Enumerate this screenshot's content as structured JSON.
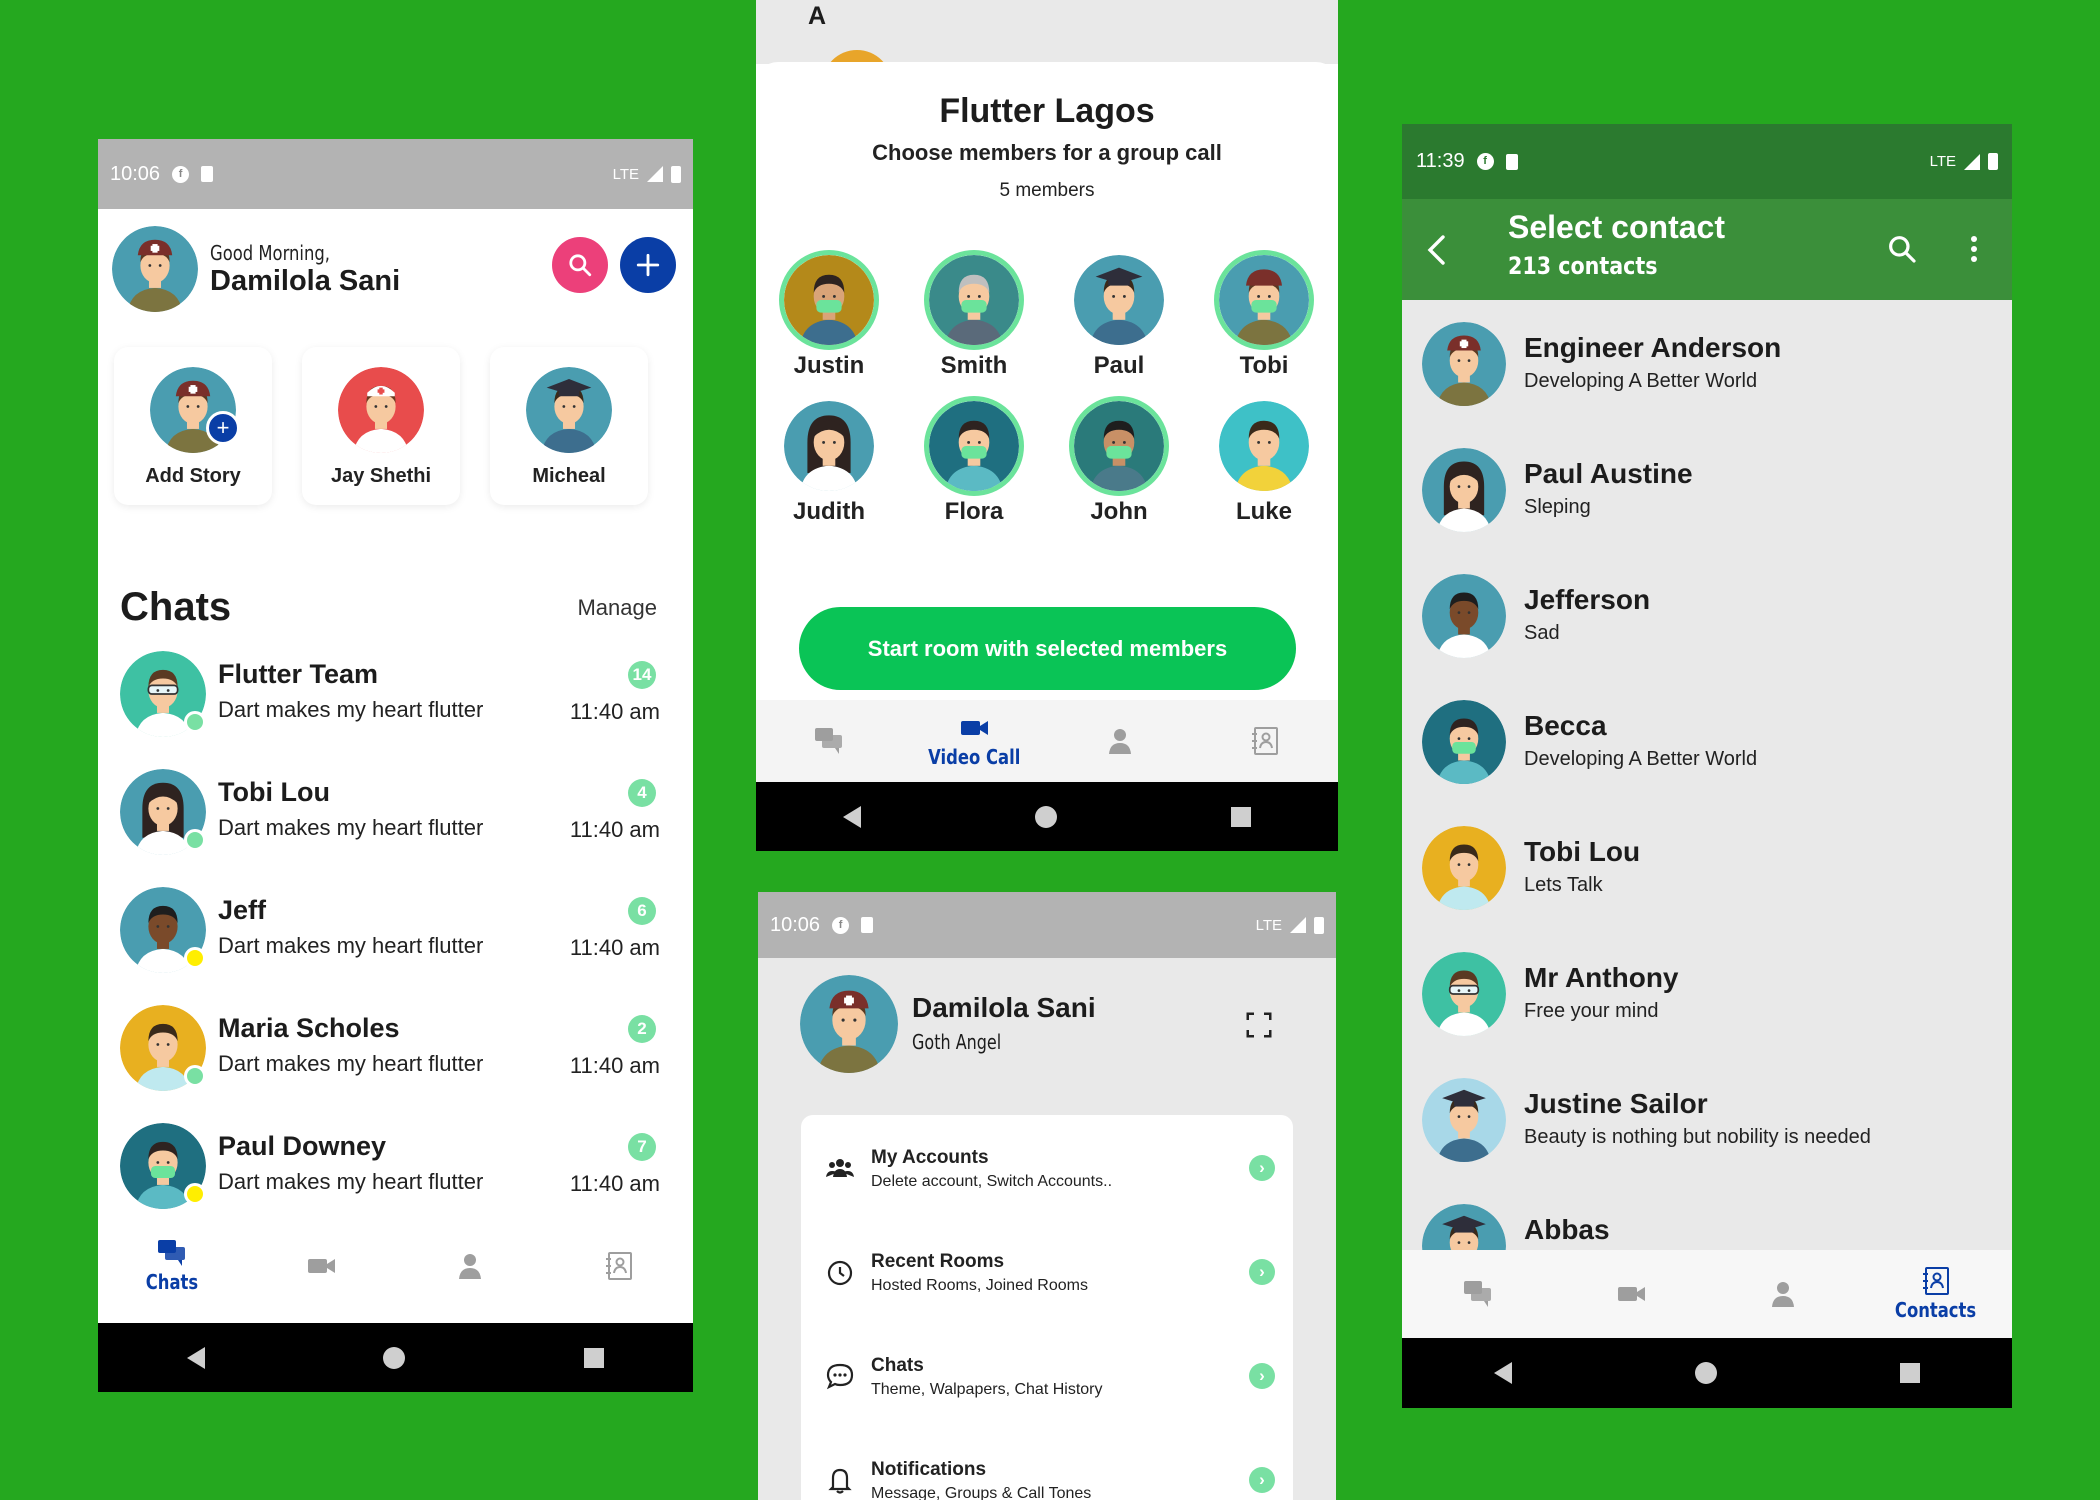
{
  "colors": {
    "background": "#25a81f",
    "accent_blue": "#0a3ea6",
    "accent_pink": "#ec407a",
    "badge_green": "#79e0a3",
    "button_green": "#0ac456",
    "appbar_green": "#3b8f3a"
  },
  "home": {
    "status_time": "10:06",
    "status_network": "LTE",
    "greeting": "Good Morning,",
    "user_name": "Damilola Sani",
    "search_icon": "search-icon",
    "add_icon": "plus-icon",
    "stories": [
      {
        "label": "Add Story",
        "avatar": "soldier"
      },
      {
        "label": "Jay Shethi",
        "avatar": "nurse"
      },
      {
        "label": "Micheal",
        "avatar": "graduate"
      }
    ],
    "chats_title": "Chats",
    "manage_label": "Manage",
    "chats": [
      {
        "name": "Flutter Team",
        "message": "Dart makes my heart flutter",
        "time": "11:40 am",
        "unread": "14",
        "avatar": "doctor-goggles",
        "online": "#79e0a3"
      },
      {
        "name": "Tobi Lou",
        "message": "Dart makes my heart flutter",
        "time": "11:40 am",
        "unread": "4",
        "avatar": "woman-doctor",
        "online": "#79e0a3"
      },
      {
        "name": "Jeff",
        "message": "Dart makes my heart flutter",
        "time": "11:40 am",
        "unread": "6",
        "avatar": "dark-doctor",
        "online": "#ffee00"
      },
      {
        "name": "Maria Scholes",
        "message": "Dart makes my heart flutter",
        "time": "11:40 am",
        "unread": "2",
        "avatar": "yellow-doctor",
        "online": "#79e0a3"
      },
      {
        "name": "Paul Downey",
        "message": "Dart makes my heart flutter",
        "time": "11:40 am",
        "unread": "7",
        "avatar": "masked-woman",
        "online": "#ffee00"
      }
    ],
    "nav": [
      {
        "label": "Chats",
        "icon": "chat-icon",
        "active": true
      },
      {
        "label": "",
        "icon": "video-icon"
      },
      {
        "label": "",
        "icon": "person-icon"
      },
      {
        "label": "",
        "icon": "contacts-icon"
      }
    ]
  },
  "group_call": {
    "top_letter": "A",
    "title": "Flutter Lagos",
    "subtitle": "Choose members for a group call",
    "count": "5 members",
    "members": [
      {
        "name": "Justin",
        "selected": true,
        "avatar": "masked-yellow"
      },
      {
        "name": "Smith",
        "selected": true,
        "avatar": "masked-old"
      },
      {
        "name": "Paul",
        "selected": false,
        "avatar": "graduate"
      },
      {
        "name": "Tobi",
        "selected": true,
        "avatar": "masked-soldier"
      },
      {
        "name": "Judith",
        "selected": false,
        "avatar": "woman-doctor"
      },
      {
        "name": "Flora",
        "selected": true,
        "avatar": "masked-woman"
      },
      {
        "name": "John",
        "selected": true,
        "avatar": "masked-man"
      },
      {
        "name": "Luke",
        "selected": false,
        "avatar": "paramedic"
      }
    ],
    "start_button": "Start room with selected members",
    "nav_active_label": "Video Call"
  },
  "settings": {
    "status_time": "10:06",
    "status_network": "LTE",
    "name": "Damilola Sani",
    "bio": "Goth Angel",
    "rows": [
      {
        "title": "My Accounts",
        "subtitle": "Delete account,  Switch Accounts..",
        "icon": "people-icon"
      },
      {
        "title": "Recent Rooms",
        "subtitle": "Hosted Rooms,  Joined Rooms",
        "icon": "history-icon"
      },
      {
        "title": "Chats",
        "subtitle": "Theme, Walpapers, Chat History",
        "icon": "chat-bubble-icon"
      },
      {
        "title": "Notifications",
        "subtitle": "Message, Groups & Call Tones",
        "icon": "bell-icon"
      }
    ]
  },
  "contacts": {
    "status_time": "11:39",
    "status_network": "LTE",
    "title": "Select contact",
    "subtitle": "213 contacts",
    "list": [
      {
        "name": "Engineer Anderson",
        "status": "Developing A Better World",
        "avatar": "soldier"
      },
      {
        "name": "Paul Austine",
        "status": "Sleping",
        "avatar": "woman-doctor"
      },
      {
        "name": "Jefferson",
        "status": "Sad",
        "avatar": "dark-doctor"
      },
      {
        "name": "Becca",
        "status": "Developing A Better World",
        "avatar": "masked-woman"
      },
      {
        "name": "Tobi Lou",
        "status": "Lets Talk",
        "avatar": "yellow-doctor"
      },
      {
        "name": "Mr Anthony",
        "status": "Free your mind",
        "avatar": "doctor-goggles"
      },
      {
        "name": "Justine Sailor",
        "status": "Beauty is nothing but nobility is needed",
        "avatar": "graduate-woman"
      },
      {
        "name": "Abbas",
        "status": "",
        "avatar": "graduate"
      }
    ],
    "nav_active_label": "Contacts"
  }
}
